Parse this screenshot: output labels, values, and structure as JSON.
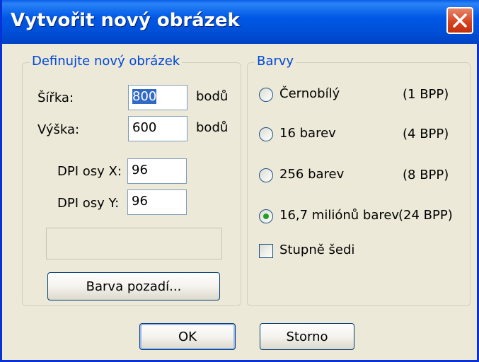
{
  "window": {
    "title": "Vytvořit nový obrázek",
    "close_icon": "close-icon"
  },
  "define_group": {
    "legend": "Definujte nový obrázek",
    "width_label": "Šířka:",
    "width_value": "800",
    "width_unit": "bodů",
    "height_label": "Výška:",
    "height_value": "600",
    "height_unit": "bodů",
    "dpi_x_label": "DPI osy X:",
    "dpi_x_value": "96",
    "dpi_y_label": "DPI osy Y:",
    "dpi_y_value": "96",
    "background_button": "Barva pozadí..."
  },
  "colors_group": {
    "legend": "Barvy",
    "options": [
      {
        "label": "Černobílý",
        "bpp": "(1 BPP)",
        "selected": false
      },
      {
        "label": "16 barev",
        "bpp": "(4 BPP)",
        "selected": false
      },
      {
        "label": "256 barev",
        "bpp": "(8 BPP)",
        "selected": false
      },
      {
        "label": "16,7 miliónů barev",
        "bpp": "(24 BPP)",
        "selected": true
      }
    ],
    "grayscale_label": "Stupně šedi",
    "grayscale_checked": false
  },
  "buttons": {
    "ok": "OK",
    "cancel": "Storno"
  },
  "colors": {
    "title_bar": "#0058e6",
    "legend_text": "#0046d5",
    "dialog_bg": "#ece9d8",
    "radio_selected": "#21a121"
  }
}
